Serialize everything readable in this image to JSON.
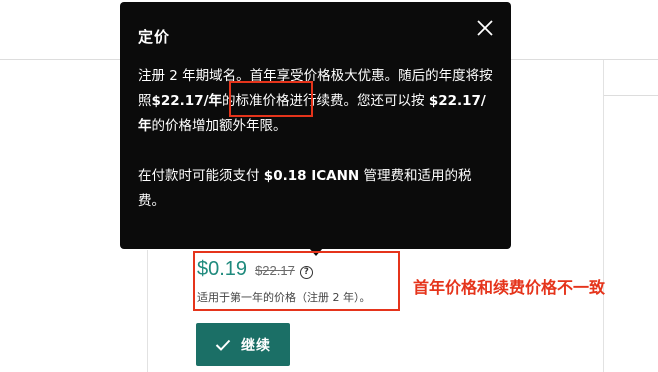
{
  "tooltip": {
    "title": "定价",
    "close_label": "关闭",
    "para1": {
      "text_a": "注册 2 年期域名。首年享受价格极大优惠。随后的年度将按照",
      "renewal_price": "$22.17/年",
      "text_b": "的标准价格进行续费。您还可以按 ",
      "extra_price": "$22.17/年",
      "text_c": "的价格增加额外年限。"
    },
    "para2": {
      "text_a": "在付款时可能须支付 ",
      "icann_fee": "$0.18 ICANN",
      "text_b": " 管理费和适用的税费。"
    }
  },
  "pricing": {
    "current_price": "$0.19",
    "original_price": "$22.17",
    "info_icon_glyph": "?",
    "note": "适用于第一年的价格（注册 2 年）。"
  },
  "continue_button": {
    "label": "继续"
  },
  "annotation": {
    "text": "首年价格和续费价格不一致",
    "color": "#e5341b"
  },
  "colors": {
    "accent": "#1f8a7d",
    "button_bg": "#1b6f66",
    "tooltip_bg": "#0b0b0b"
  },
  "icons": {
    "close": "close-icon",
    "info": "info-icon",
    "check": "check-icon"
  }
}
